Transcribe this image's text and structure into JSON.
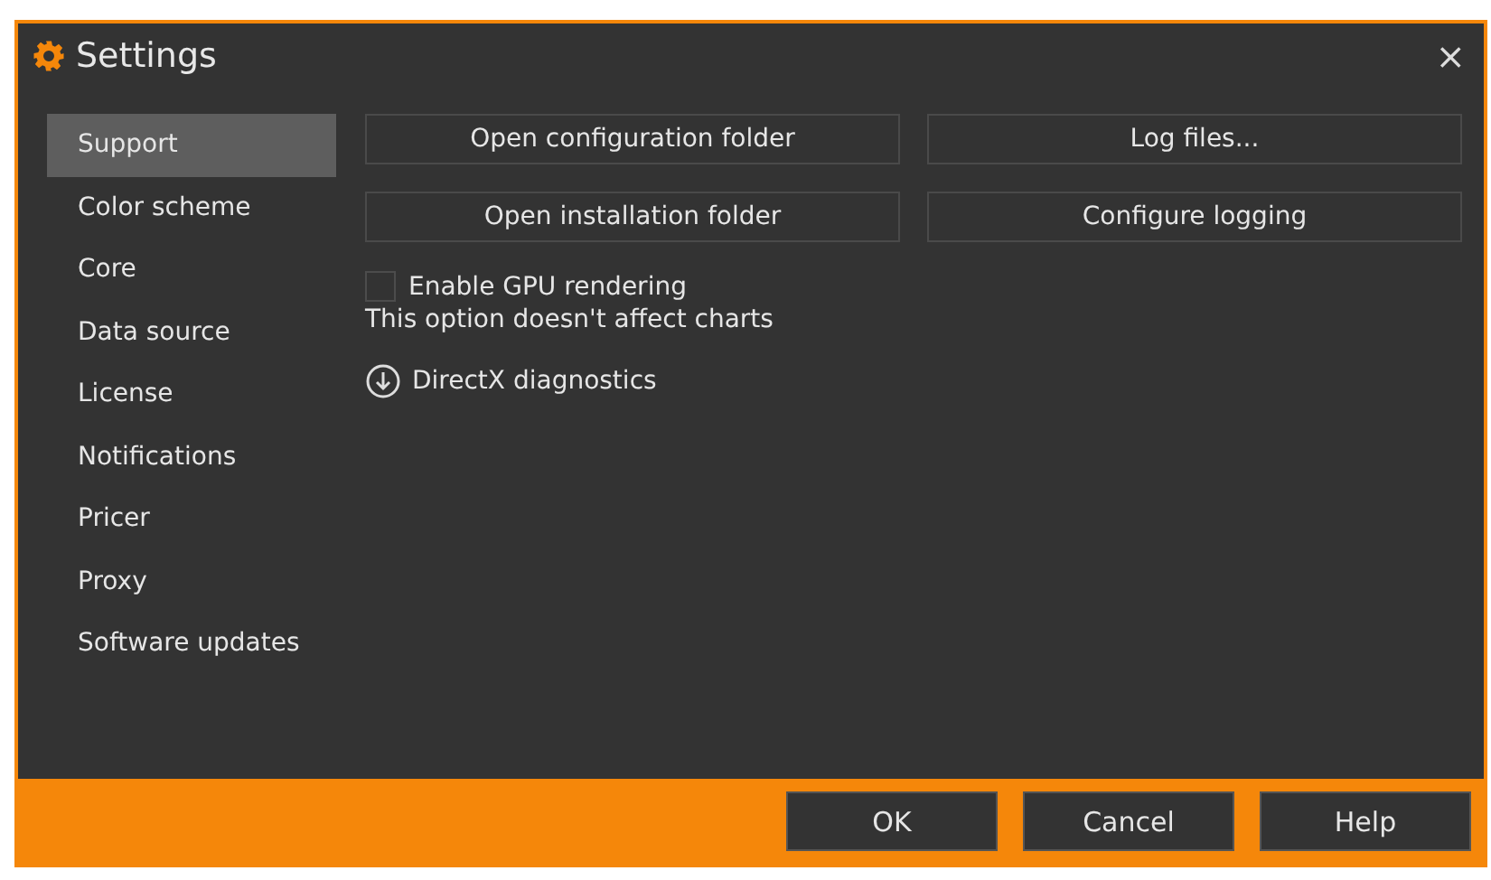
{
  "window": {
    "title": "Settings",
    "close": "×"
  },
  "sidebar": {
    "items": [
      {
        "label": "Support",
        "selected": true
      },
      {
        "label": "Color scheme",
        "selected": false
      },
      {
        "label": "Core",
        "selected": false
      },
      {
        "label": "Data source",
        "selected": false
      },
      {
        "label": "License",
        "selected": false
      },
      {
        "label": "Notifications",
        "selected": false
      },
      {
        "label": "Pricer",
        "selected": false
      },
      {
        "label": "Proxy",
        "selected": false
      },
      {
        "label": "Software updates",
        "selected": false
      }
    ]
  },
  "actions": [
    "Open configuration folder",
    "Log files...",
    "Open installation folder",
    "Configure logging"
  ],
  "gpu": {
    "label": "Enable GPU rendering",
    "checked": false,
    "note": "This option doesn't affect charts"
  },
  "diagnostics": {
    "label": "DirectX diagnostics"
  },
  "footer": {
    "buttons": [
      "OK",
      "Cancel",
      "Help"
    ]
  }
}
